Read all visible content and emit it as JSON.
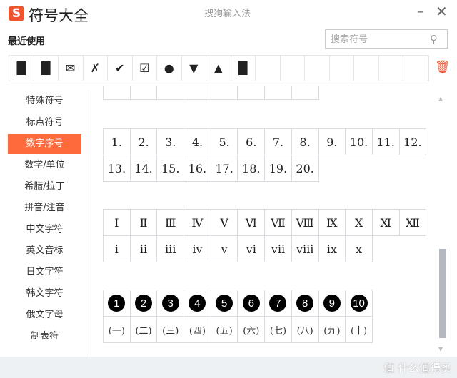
{
  "header": {
    "logo": "S",
    "title": "符号大全",
    "ime_name": "搜狗输入法",
    "minimize": "–",
    "close": "✕"
  },
  "recent": {
    "label": "最近使用",
    "items": [
      "█",
      "█",
      "✉",
      "✗",
      "✔",
      "☑",
      "●",
      "▼",
      "▲",
      "█",
      "",
      "",
      "",
      "",
      "",
      "",
      ""
    ],
    "clear_icon": "🗑"
  },
  "search": {
    "placeholder": "搜索符号",
    "icon": "⚲"
  },
  "sidebar": {
    "items": [
      "特殊符号",
      "标点符号",
      "数字序号",
      "数学/单位",
      "希腊/拉丁",
      "拼音/注音",
      "中文字符",
      "英文音标",
      "日文字符",
      "韩文字符",
      "俄文字母",
      "制表符"
    ],
    "active": "数字序号"
  },
  "sections": {
    "numbered": [
      "1.",
      "2.",
      "3.",
      "4.",
      "5.",
      "6.",
      "7.",
      "8.",
      "9.",
      "10.",
      "11.",
      "12.",
      "13.",
      "14.",
      "15.",
      "16.",
      "17.",
      "18.",
      "19.",
      "20."
    ],
    "roman_upper": [
      "Ⅰ",
      "Ⅱ",
      "Ⅲ",
      "Ⅳ",
      "Ⅴ",
      "Ⅵ",
      "Ⅶ",
      "Ⅷ",
      "Ⅸ",
      "Ⅹ",
      "Ⅺ",
      "Ⅻ"
    ],
    "roman_lower": [
      "ⅰ",
      "ⅱ",
      "ⅲ",
      "ⅳ",
      "ⅴ",
      "ⅵ",
      "ⅶ",
      "ⅷ",
      "ⅸ",
      "ⅹ"
    ],
    "circled": [
      "1",
      "2",
      "3",
      "4",
      "5",
      "6",
      "7",
      "8",
      "9",
      "10"
    ],
    "paren_cn": [
      "(一)",
      "(二)",
      "(三)",
      "(四)",
      "(五)",
      "(六)",
      "(七)",
      "(八)",
      "(九)",
      "(十)"
    ]
  },
  "scroll": {
    "position_fraction": 0.8
  },
  "watermark": "值 什么值得买"
}
